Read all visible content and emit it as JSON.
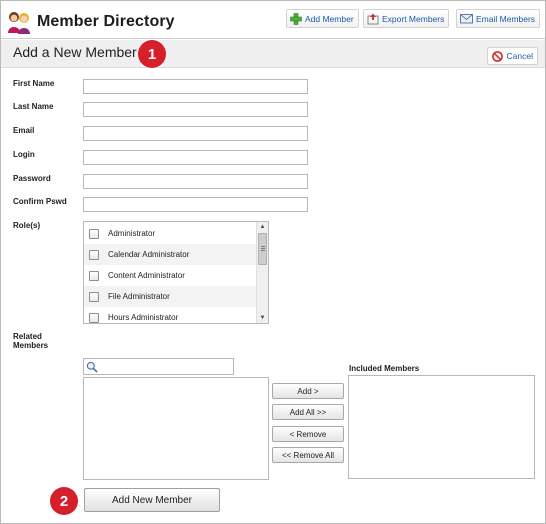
{
  "header": {
    "title": "Member Directory",
    "actions": [
      {
        "label": "Add Member",
        "icon": "green-plus-icon"
      },
      {
        "label": "Export Members",
        "icon": "export-icon"
      },
      {
        "label": "Email Members",
        "icon": "envelope-icon"
      }
    ]
  },
  "section": {
    "title": "Add a New Member",
    "cancel_label": "Cancel",
    "cancel_icon": "no-entry-icon"
  },
  "callouts": [
    "1",
    "2"
  ],
  "form": {
    "fields": [
      {
        "label": "First Name",
        "value": ""
      },
      {
        "label": "Last Name",
        "value": ""
      },
      {
        "label": "Email",
        "value": ""
      },
      {
        "label": "Login",
        "value": ""
      },
      {
        "label": "Password",
        "value": ""
      },
      {
        "label": "Confirm Pswd",
        "value": ""
      }
    ],
    "roles_label": "Role(s)",
    "roles": [
      {
        "label": "Administrator",
        "checked": false
      },
      {
        "label": "Calendar Administrator",
        "checked": false
      },
      {
        "label": "Content Administrator",
        "checked": false
      },
      {
        "label": "File Administrator",
        "checked": false
      },
      {
        "label": "Hours Administrator",
        "checked": false
      }
    ],
    "related_label": "Related Members",
    "related_search_value": "",
    "included_label": "Included Members",
    "transfer_buttons": {
      "add": "Add >",
      "add_all": "Add All >>",
      "remove": "< Remove",
      "remove_all": "<< Remove All"
    },
    "submit_label": "Add New Member"
  },
  "colors": {
    "accent_link": "#1e5aa8",
    "callout_red": "#d71f2c",
    "section_bg": "#efefef"
  }
}
